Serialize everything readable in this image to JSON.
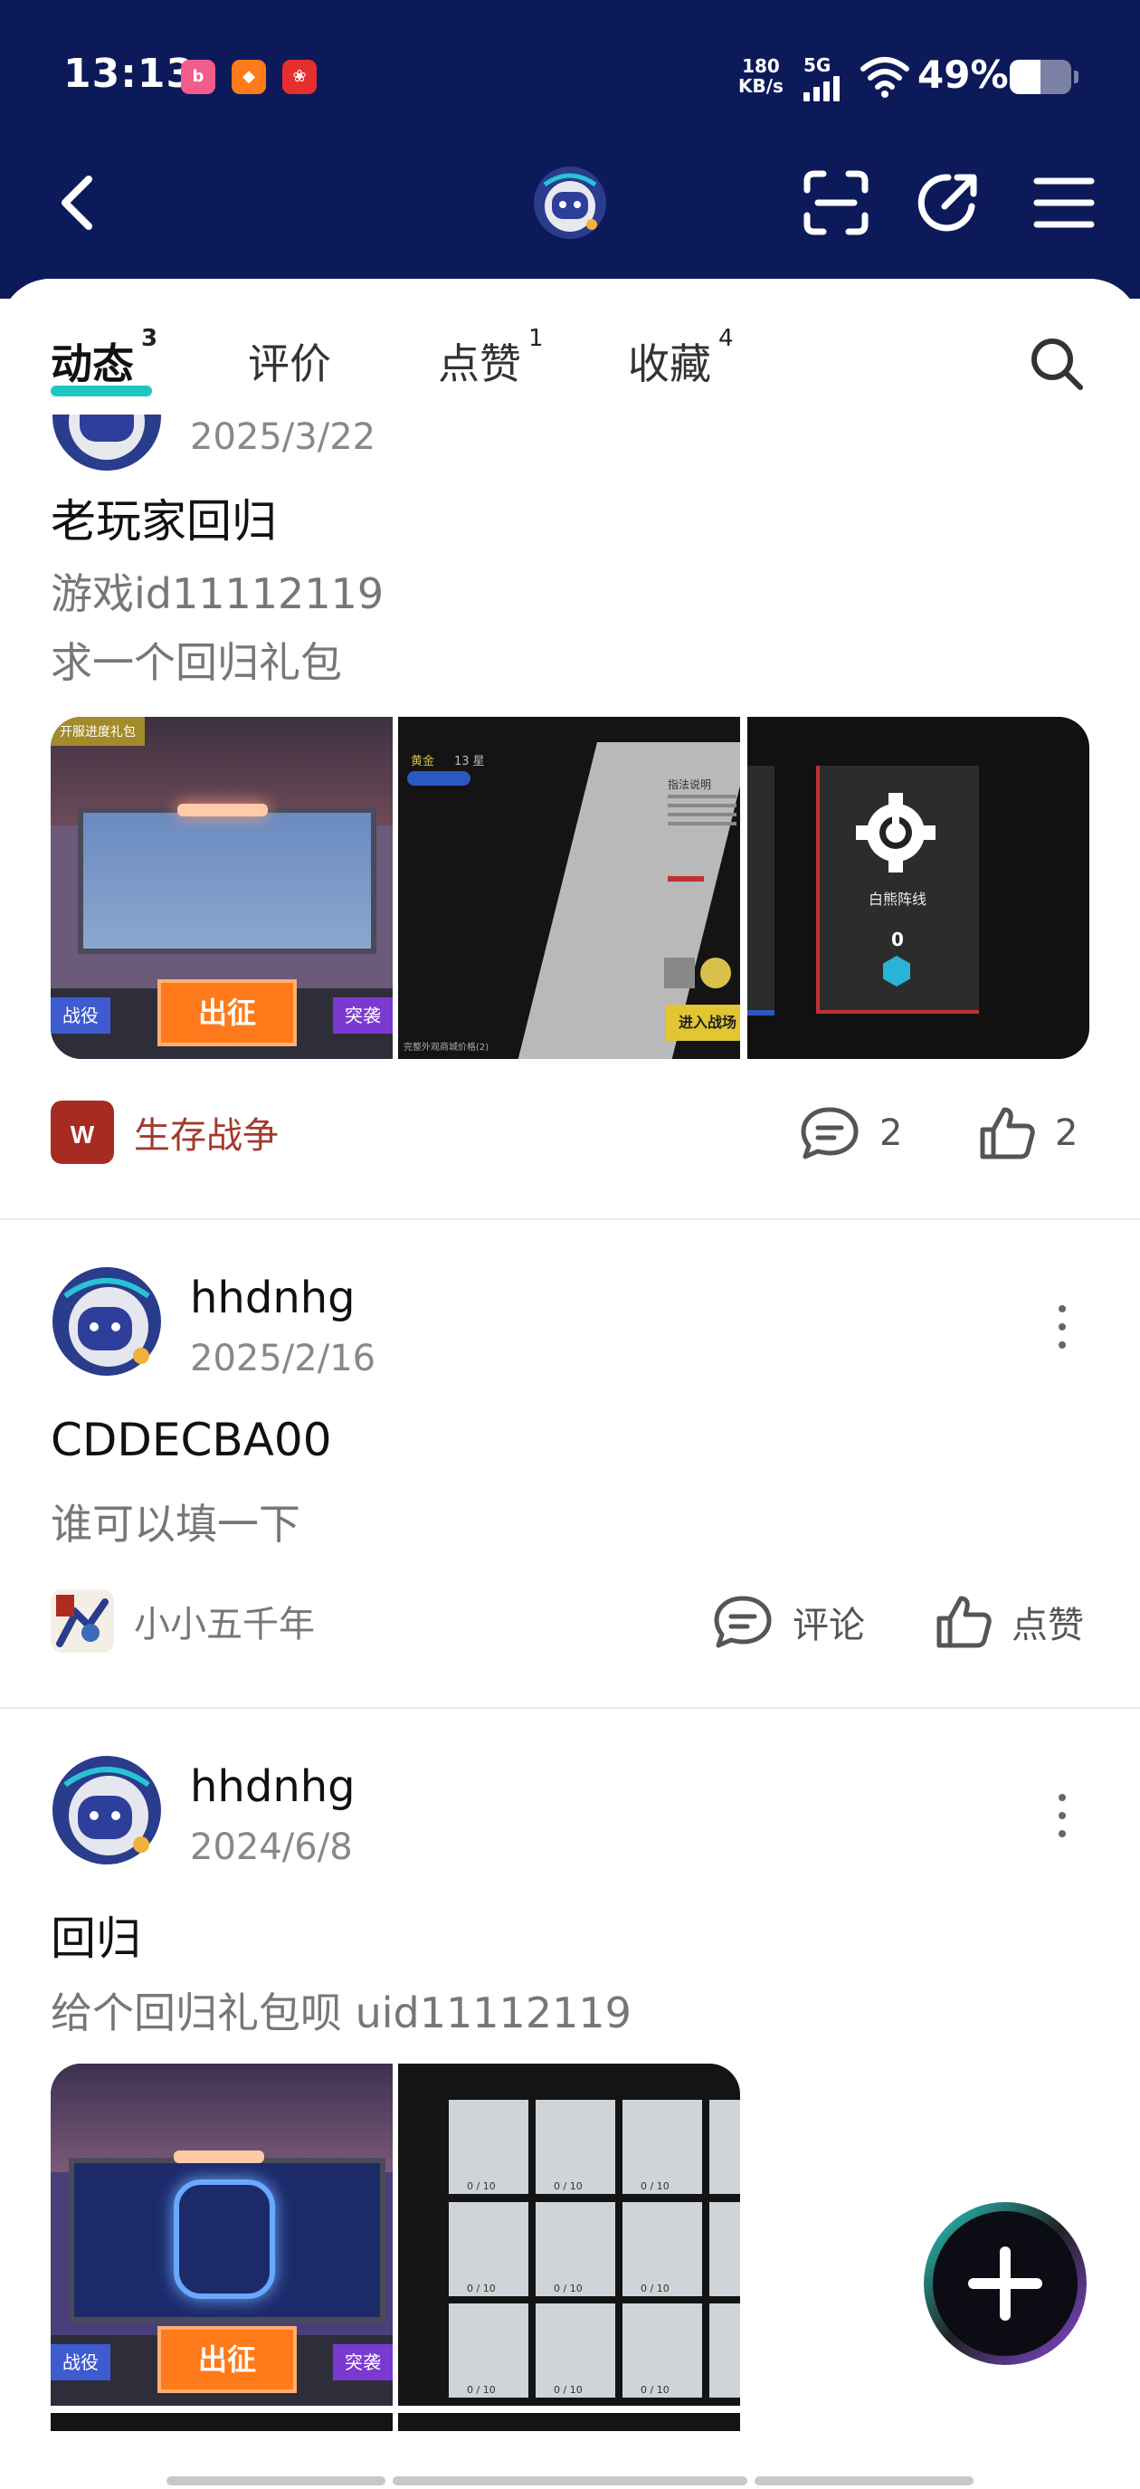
{
  "status_bar": {
    "time": "13:13",
    "net_speed_value": "180",
    "net_speed_unit": "KB/s",
    "network_type": "5G",
    "battery": "49%"
  },
  "tabs": [
    {
      "label": "动态",
      "badge": "3"
    },
    {
      "label": "评价",
      "badge": ""
    },
    {
      "label": "点赞",
      "badge": "1"
    },
    {
      "label": "收藏",
      "badge": "4"
    }
  ],
  "posts": [
    {
      "date": "2025/3/22",
      "title": "老玩家回归",
      "body_lines": [
        "游戏id11112119",
        "求一个回归礼包"
      ],
      "game": "生存战争",
      "comment_label": "2",
      "like_label": "2",
      "images": [
        {
          "tag": "开服进度礼包",
          "left_btn": "战役",
          "center_btn": "出征",
          "right_btn": "突袭"
        },
        {
          "rank": "黄金",
          "stars": "13 星",
          "title": "指法说明",
          "btn": "进入战场",
          "footer": "完整外观商城价格(2)"
        },
        {
          "caption": "白熊阵线",
          "number": "0"
        }
      ]
    },
    {
      "user": "hhdnhg",
      "date": "2025/2/16",
      "title": "CDDECBA00",
      "body_lines": [
        "谁可以填一下"
      ],
      "game": "小小五千年",
      "comment_label": "评论",
      "like_label": "点赞"
    },
    {
      "user": "hhdnhg",
      "date": "2024/6/8",
      "title": "回归",
      "body_lines": [
        "给个回归礼包呗 uid11112119"
      ],
      "images": [
        {
          "left_btn": "战役",
          "center_btn": "出征",
          "right_btn": "突袭"
        },
        {
          "cell_counts": [
            "0 / 10",
            "0 / 10",
            "0 / 10",
            "0 / 10",
            "0 / 10",
            "0 / 10",
            "0 / 10",
            "0 / 10",
            "0 / 10"
          ]
        }
      ]
    }
  ],
  "colors": {
    "header_bg": "#0d1a5a",
    "tab_underline": "#1cc7c0",
    "game_name_red": "#a33a2e"
  },
  "icons": [
    "back-icon",
    "scan-icon",
    "share-icon",
    "menu-icon",
    "search-icon",
    "comment-icon",
    "thumbs-up-icon",
    "more-icon",
    "plus-icon"
  ]
}
